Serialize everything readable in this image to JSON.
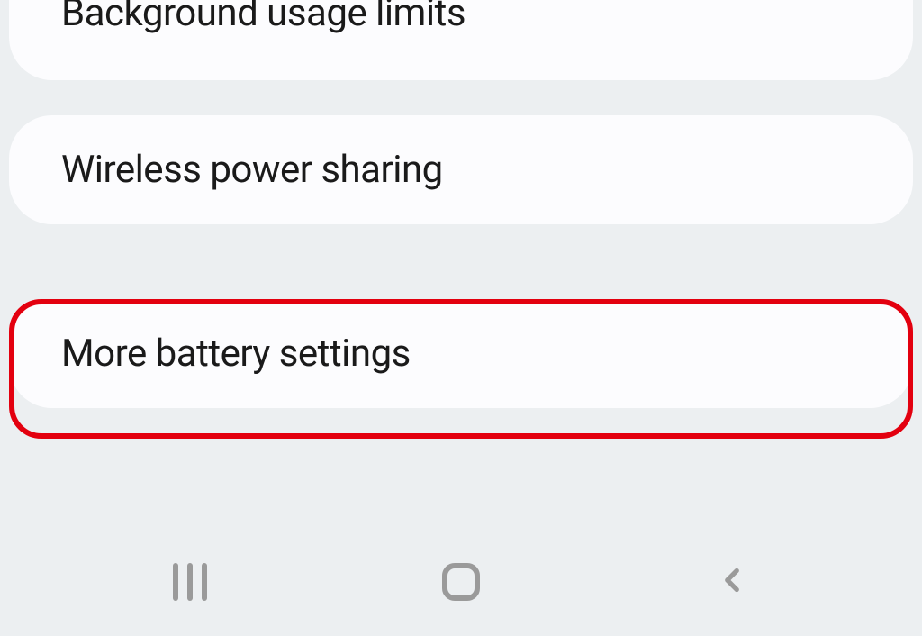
{
  "settings": {
    "items": [
      {
        "label": "Background usage limits"
      },
      {
        "label": "Wireless power sharing"
      },
      {
        "label": "More battery settings"
      }
    ]
  },
  "nav": {
    "recents": "recents",
    "home": "home",
    "back": "back"
  }
}
